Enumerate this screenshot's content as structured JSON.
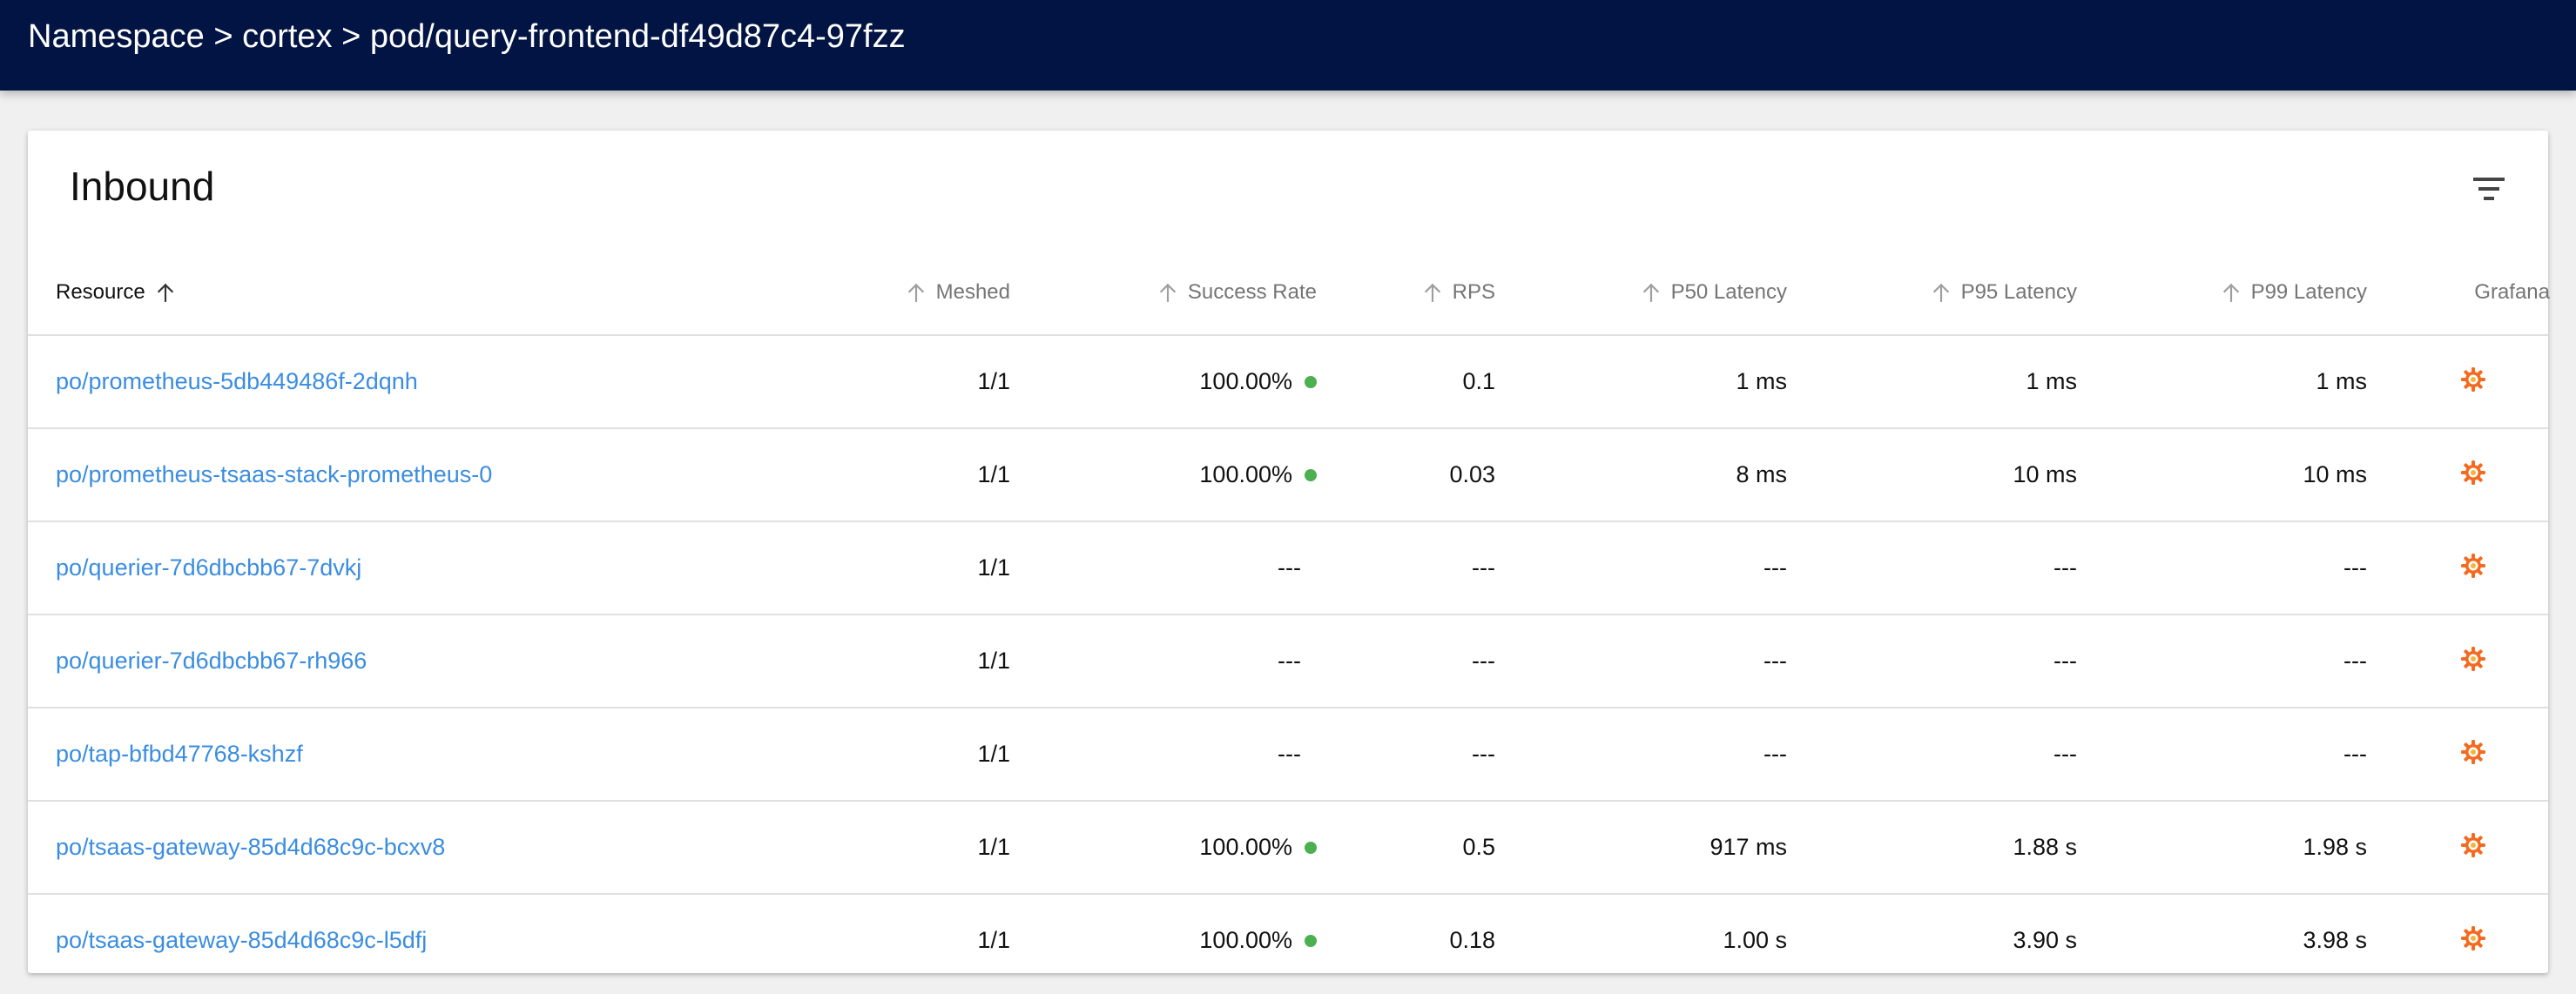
{
  "breadcrumb": {
    "items": [
      "Namespace",
      "cortex",
      "pod/query-frontend-df49d87c4-97fzz"
    ],
    "separator": " > "
  },
  "card": {
    "title": "Inbound",
    "filter_icon": "filter-list-icon"
  },
  "table": {
    "columns": [
      {
        "key": "resource",
        "label": "Resource",
        "sorted": "ascending"
      },
      {
        "key": "meshed",
        "label": "Meshed"
      },
      {
        "key": "success_rate",
        "label": "Success Rate"
      },
      {
        "key": "rps",
        "label": "RPS"
      },
      {
        "key": "p50",
        "label": "P50 Latency"
      },
      {
        "key": "p95",
        "label": "P95 Latency"
      },
      {
        "key": "p99",
        "label": "P99 Latency"
      },
      {
        "key": "grafana",
        "label": "Grafana"
      }
    ],
    "rows": [
      {
        "resource": "po/prometheus-5db449486f-2dqnh",
        "meshed": "1/1",
        "success_rate": "100.00%",
        "healthy": true,
        "rps": "0.1",
        "p50": "1 ms",
        "p95": "1 ms",
        "p99": "1 ms"
      },
      {
        "resource": "po/prometheus-tsaas-stack-prometheus-0",
        "meshed": "1/1",
        "success_rate": "100.00%",
        "healthy": true,
        "rps": "0.03",
        "p50": "8 ms",
        "p95": "10 ms",
        "p99": "10 ms"
      },
      {
        "resource": "po/querier-7d6dbcbb67-7dvkj",
        "meshed": "1/1",
        "success_rate": "---",
        "healthy": false,
        "rps": "---",
        "p50": "---",
        "p95": "---",
        "p99": "---"
      },
      {
        "resource": "po/querier-7d6dbcbb67-rh966",
        "meshed": "1/1",
        "success_rate": "---",
        "healthy": false,
        "rps": "---",
        "p50": "---",
        "p95": "---",
        "p99": "---"
      },
      {
        "resource": "po/tap-bfbd47768-kshzf",
        "meshed": "1/1",
        "success_rate": "---",
        "healthy": false,
        "rps": "---",
        "p50": "---",
        "p95": "---",
        "p99": "---"
      },
      {
        "resource": "po/tsaas-gateway-85d4d68c9c-bcxv8",
        "meshed": "1/1",
        "success_rate": "100.00%",
        "healthy": true,
        "rps": "0.5",
        "p50": "917 ms",
        "p95": "1.88 s",
        "p99": "1.98 s"
      },
      {
        "resource": "po/tsaas-gateway-85d4d68c9c-l5dfj",
        "meshed": "1/1",
        "success_rate": "100.00%",
        "healthy": true,
        "rps": "0.18",
        "p50": "1.00 s",
        "p95": "3.90 s",
        "p99": "3.98 s"
      }
    ]
  },
  "icons": {
    "sort": "arrow-up-icon",
    "grafana": "grafana-icon",
    "status": "status-dot-icon"
  },
  "colors": {
    "header_bg": "#021443",
    "link": "#3a8de0",
    "success_dot": "#4caf50",
    "grafana_orange": "#f26b21"
  }
}
